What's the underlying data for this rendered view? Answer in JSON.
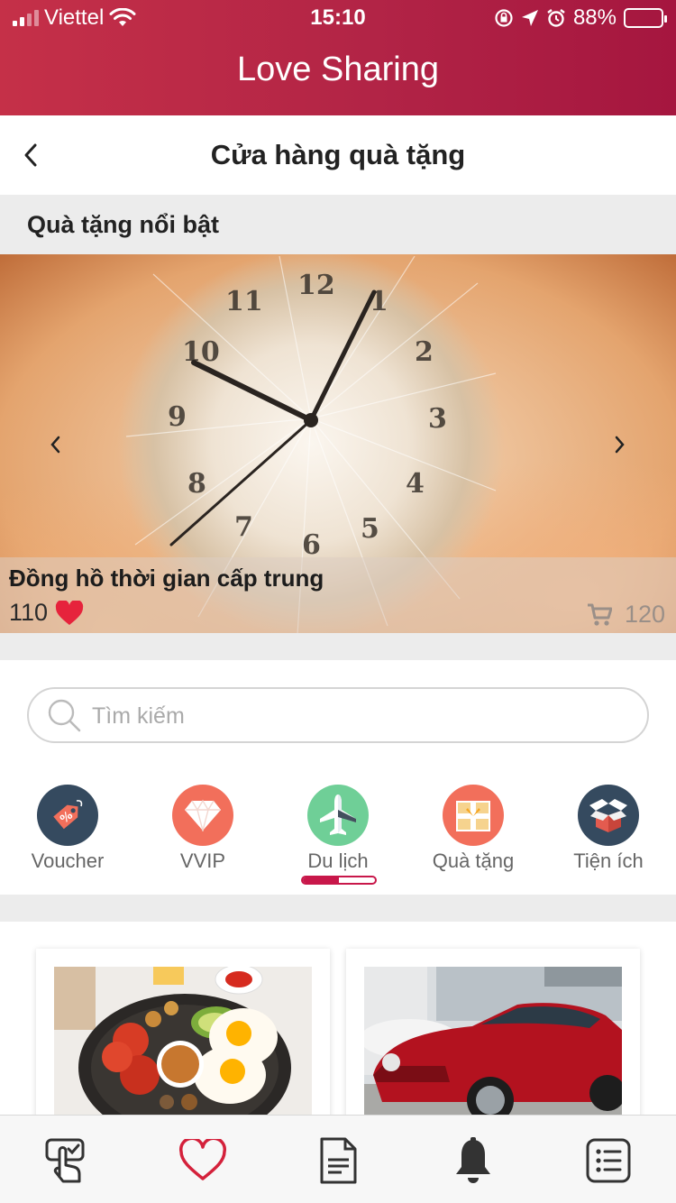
{
  "status_bar": {
    "carrier": "Viettel",
    "time": "15:10",
    "battery": "88%",
    "battery_level": 0.88,
    "icons": [
      "signal-icon",
      "wifi-icon",
      "rotation-lock-icon",
      "location-icon",
      "alarm-icon",
      "battery-icon"
    ]
  },
  "header": {
    "app_title": "Love Sharing"
  },
  "nav": {
    "title": "Cửa hàng quà tặng",
    "back_icon": "chevron-left-icon"
  },
  "featured": {
    "section_title": "Quà tặng nổi bật",
    "item": {
      "name": "Đồng hồ thời gian cấp trung",
      "hearts": "110",
      "cart_count": "120"
    }
  },
  "search": {
    "placeholder": "Tìm kiếm",
    "value": ""
  },
  "categories": [
    {
      "label": "Voucher",
      "icon": "voucher-tag-icon",
      "color": "#354a5f"
    },
    {
      "label": "VVIP",
      "icon": "diamond-icon",
      "color": "#f26f5b"
    },
    {
      "label": "Du lịch",
      "icon": "airplane-icon",
      "color": "#6fcf97",
      "selected": true
    },
    {
      "label": "Quà tặng",
      "icon": "gift-box-icon",
      "color": "#f26f5b"
    },
    {
      "label": "Tiện ích",
      "icon": "package-box-icon",
      "color": "#354a5f"
    }
  ],
  "category_scroll_fraction": 0.5,
  "products": [
    {
      "image": "breakfast-plate-image"
    },
    {
      "image": "red-car-image"
    }
  ],
  "tab_bar": {
    "items": [
      {
        "icon": "touch-hand-icon",
        "active": false
      },
      {
        "icon": "heart-icon",
        "active": true
      },
      {
        "icon": "document-icon",
        "active": false
      },
      {
        "icon": "bell-icon",
        "active": false
      },
      {
        "icon": "list-icon",
        "active": false
      }
    ]
  },
  "colors": {
    "brand": "#b3213f",
    "accent": "#c8174a",
    "heart": "#e6233c"
  }
}
